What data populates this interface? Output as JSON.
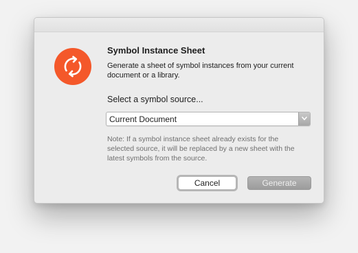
{
  "dialog": {
    "title": "Symbol Instance Sheet",
    "description": "Generate a sheet of symbol instances from your current document or a library.",
    "source_prompt": "Select a symbol source...",
    "source_select": {
      "selected": "Current Document"
    },
    "note": "Note: If a symbol instance sheet already exists for the selected source, it will be replaced by a new sheet with the latest symbols from the source.",
    "cancel_label": "Cancel",
    "generate_label": "Generate"
  },
  "icon": {
    "name": "refresh-cycle-icon",
    "color": "#f4582a"
  }
}
